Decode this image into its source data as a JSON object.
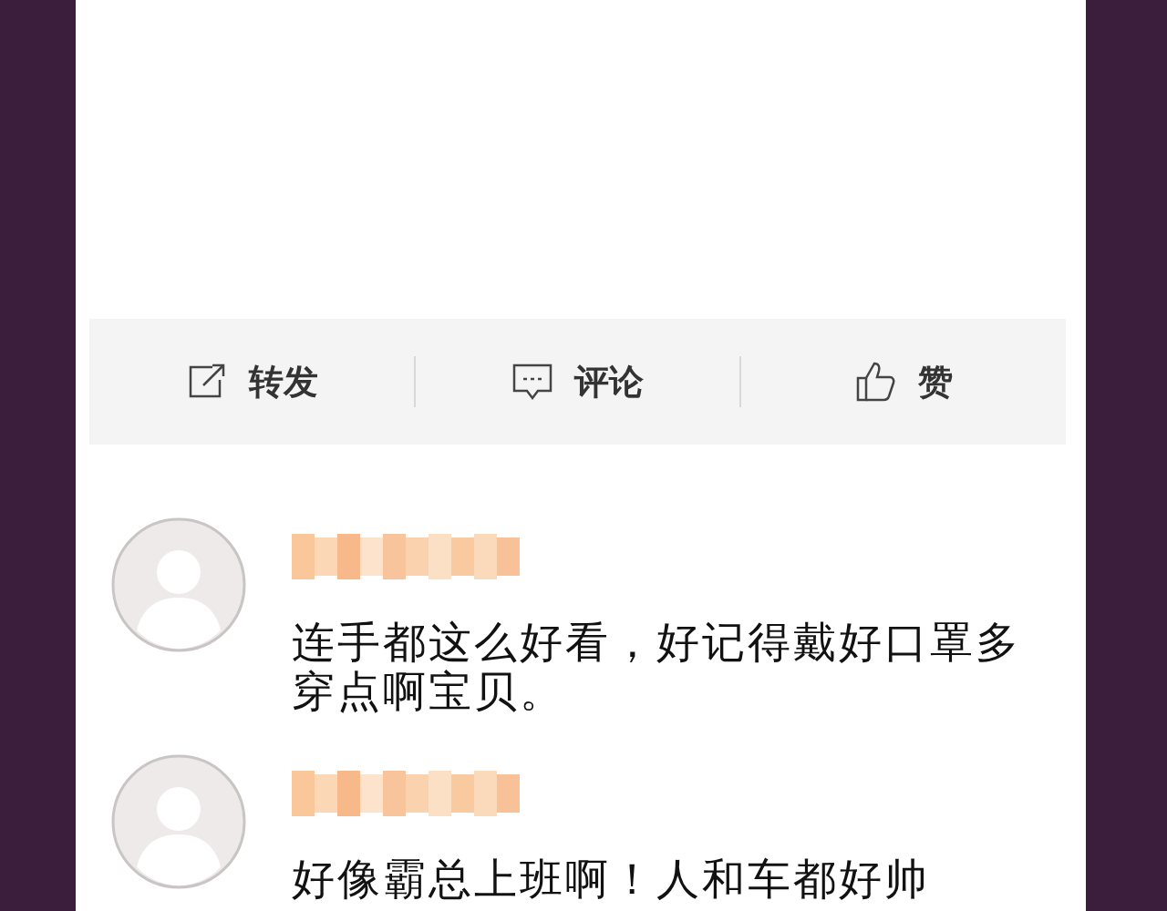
{
  "actions": [
    {
      "kind": "share",
      "label": "转发"
    },
    {
      "kind": "comment",
      "label": "评论"
    },
    {
      "kind": "like",
      "label": "赞"
    }
  ],
  "comments": [
    {
      "text": "连手都这么好看，好记得戴好口罩多穿点啊宝贝。"
    },
    {
      "text": "好像霸总上班啊！人和车都好帅"
    }
  ]
}
